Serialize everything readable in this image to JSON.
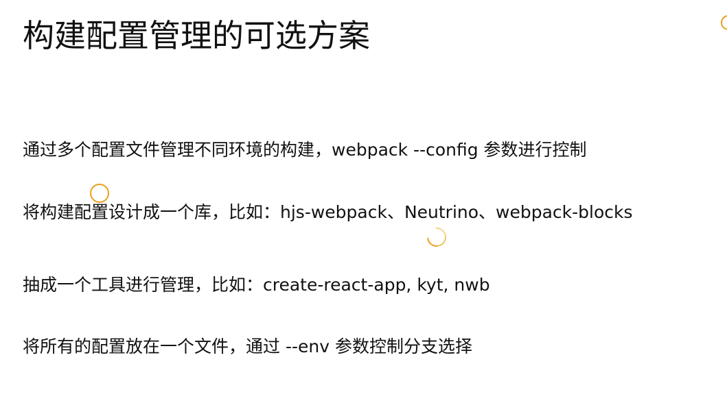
{
  "slide": {
    "title": "构建配置管理的可选方案",
    "bullets": [
      "通过多个配置文件管理不同环境的构建，webpack --config 参数进行控制",
      "将构建配置设计成一个库，比如：hjs-webpack、Neutrino、webpack-blocks",
      "抽成一个工具进行管理，比如：create-react-app, kyt, nwb",
      "将所有的配置放在一个文件，通过 --env 参数控制分支选择"
    ]
  },
  "colors": {
    "cursor_ring": "#e8a020",
    "text": "#111111",
    "background": "#ffffff"
  }
}
